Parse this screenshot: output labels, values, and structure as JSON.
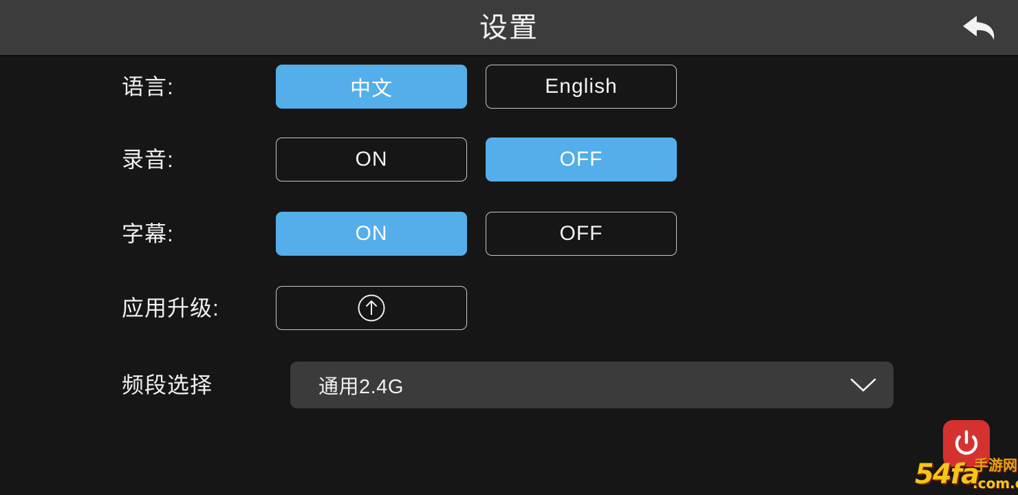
{
  "header": {
    "title": "设置",
    "back_icon": "back-arrow-icon"
  },
  "colors": {
    "accent_blue": "#54aee9",
    "background": "#161616",
    "header_background": "#3c3c3c",
    "dropdown_background": "#3b3b3b",
    "power_red": "#d5322f",
    "watermark_yellow": "#f5c518"
  },
  "settings": {
    "rows": [
      {
        "id": "language",
        "label": "语言:",
        "options": [
          {
            "label": "中文",
            "selected": true
          },
          {
            "label": "English",
            "selected": false
          }
        ]
      },
      {
        "id": "recording",
        "label": "录音:",
        "options": [
          {
            "label": "ON",
            "selected": false
          },
          {
            "label": "OFF",
            "selected": true
          }
        ]
      },
      {
        "id": "subtitle",
        "label": "字幕:",
        "options": [
          {
            "label": "ON",
            "selected": true
          },
          {
            "label": "OFF",
            "selected": false
          }
        ]
      },
      {
        "id": "upgrade",
        "label": "应用升级:",
        "icon": "circle-up-arrow-icon"
      },
      {
        "id": "band",
        "label": "频段选择",
        "dropdown": {
          "value": "通用2.4G",
          "chevron_icon": "chevron-down-icon"
        }
      }
    ]
  },
  "power": {
    "icon": "power-icon"
  },
  "watermark": {
    "main": "54fa",
    "cn": "手游网",
    "domain": ".com.cn"
  }
}
